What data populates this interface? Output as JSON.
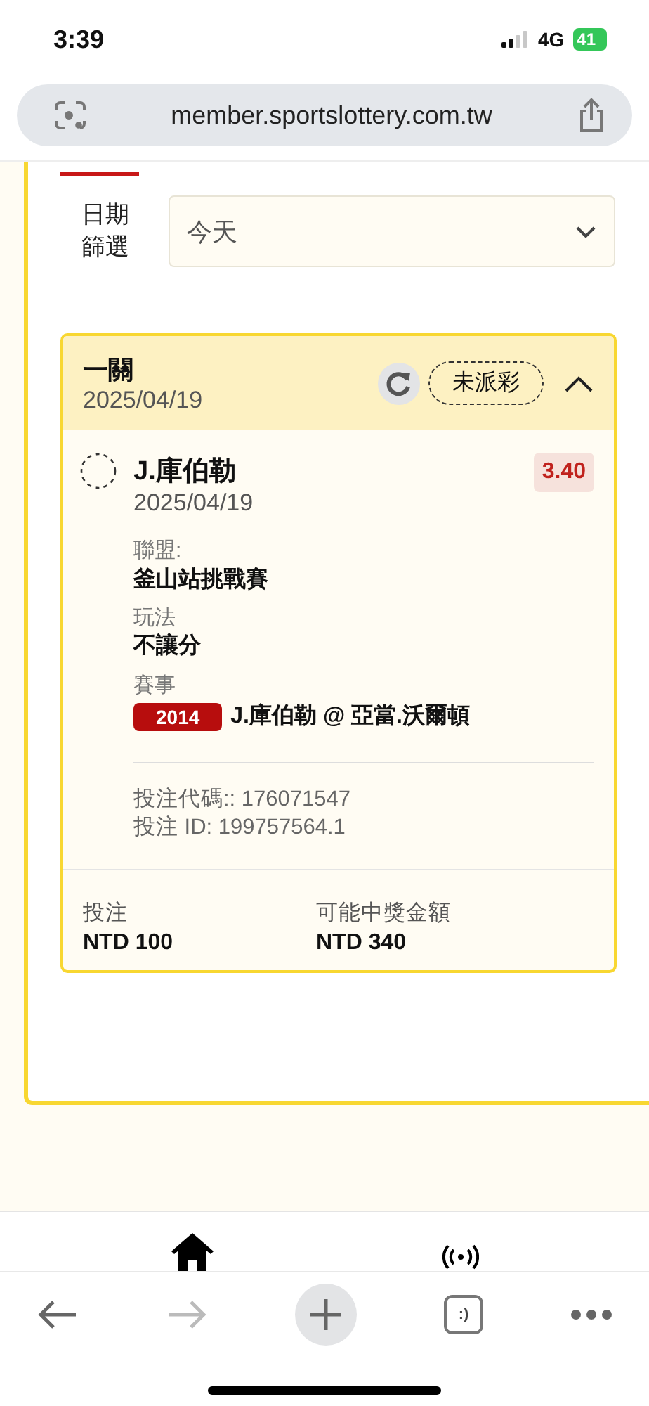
{
  "status_bar": {
    "time": "3:39",
    "network": "4G",
    "battery": "41"
  },
  "browser": {
    "url": "member.sportslottery.com.tw",
    "tabs_label": ":)",
    "forward_disabled": true
  },
  "filter": {
    "label": "日期篩選",
    "value": "今天"
  },
  "bet": {
    "type": "一關",
    "date": "2025/04/19",
    "status": "未派彩",
    "expanded": true,
    "selection": {
      "name": "J.庫伯勒",
      "date": "2025/04/19",
      "odds": "3.40"
    },
    "details": [
      {
        "label": "聯盟:",
        "value": "釜山站挑戰賽"
      },
      {
        "label": "玩法",
        "value": "不讓分"
      }
    ],
    "event": {
      "label": "賽事",
      "code": "2014",
      "match": "J.庫伯勒 @ 亞當.沃爾頓"
    },
    "bet_code": "投注代碼:: 176071547",
    "bet_id": "投注 ID: 199757564.1",
    "totals": [
      {
        "label": "投注",
        "value": "NTD 100"
      },
      {
        "label": "可能中獎金額",
        "value": "NTD 340"
      }
    ]
  }
}
